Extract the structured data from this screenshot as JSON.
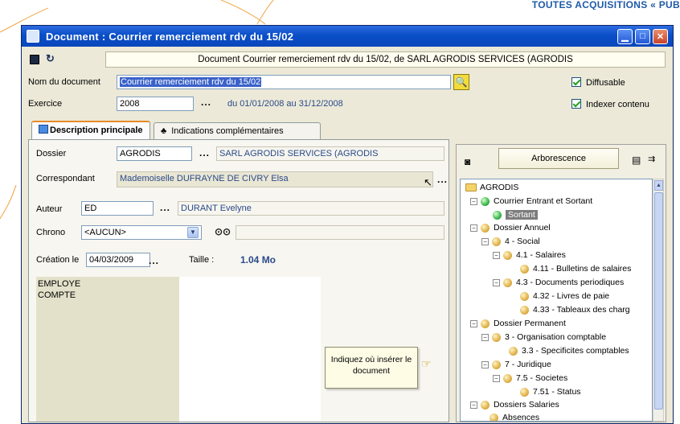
{
  "banner": {
    "text": "TOUTES ACQUISITIONS « PUB"
  },
  "window": {
    "title": "Document : Courrier remerciement rdv du 15/02",
    "doc_header": "Document Courrier remerciement rdv du 15/02, de SARL AGRODIS SERVICES (AGRODIS"
  },
  "form": {
    "nom_label": "Nom du document",
    "nom_value": "Courrier remerciement rdv du 15/02",
    "exercice_label": "Exercice",
    "exercice_value": "2008",
    "exercice_range": "du 01/01/2008 au 31/12/2008",
    "diffusable_label": "Diffusable",
    "indexer_label": "Indexer contenu",
    "dots": "..."
  },
  "tabs": [
    {
      "label": "Description principale"
    },
    {
      "label": "Indications complémentaires"
    }
  ],
  "panel": {
    "dossier_label": "Dossier",
    "dossier_code": "AGRODIS",
    "dossier_name": "SARL AGRODIS SERVICES (AGRODIS",
    "correspondant_label": "Correspondant",
    "correspondant_value": "Mademoiselle DUFRAYNE DE CIVRY Elsa",
    "auteur_label": "Auteur",
    "auteur_code": "ED",
    "auteur_name": "DURANT Evelyne",
    "chrono_label": "Chrono",
    "chrono_value": "<AUCUN>",
    "creation_label": "Création le",
    "creation_value": "04/03/2009",
    "taille_label": "Taille :",
    "taille_value": "1.04 Mo",
    "memo_line1": "EMPLOYE",
    "memo_line2": "COMPTE"
  },
  "tooltip": {
    "line1": "Indiquez où insérer le",
    "line2": "document"
  },
  "tree": {
    "button_label": "Arborescence",
    "items": [
      {
        "label": "AGRODIS"
      },
      {
        "label": "Courrier Entrant et Sortant"
      },
      {
        "label": "Sortant"
      },
      {
        "label": "Dossier Annuel"
      },
      {
        "label": "4 - Social"
      },
      {
        "label": "4.1 - Salaires"
      },
      {
        "label": "4.11 - Bulletins de salaires"
      },
      {
        "label": "4.3 - Documents periodiques"
      },
      {
        "label": "4.32 - Livres de paie"
      },
      {
        "label": "4.33 - Tableaux des charg"
      },
      {
        "label": "Dossier Permanent"
      },
      {
        "label": "3 - Organisation comptable"
      },
      {
        "label": "3.3 - Specificites comptables"
      },
      {
        "label": "7 - Juridique"
      },
      {
        "label": "7.5 - Societes"
      },
      {
        "label": "7.51 - Status"
      },
      {
        "label": "Dossiers Salaries"
      },
      {
        "label": "Absences"
      }
    ]
  },
  "colors": {
    "title_bar": "#0a4fc8",
    "selection": "#3a62c9",
    "accent_tab": "#e68b2c",
    "banner": "#1e5aa8"
  }
}
